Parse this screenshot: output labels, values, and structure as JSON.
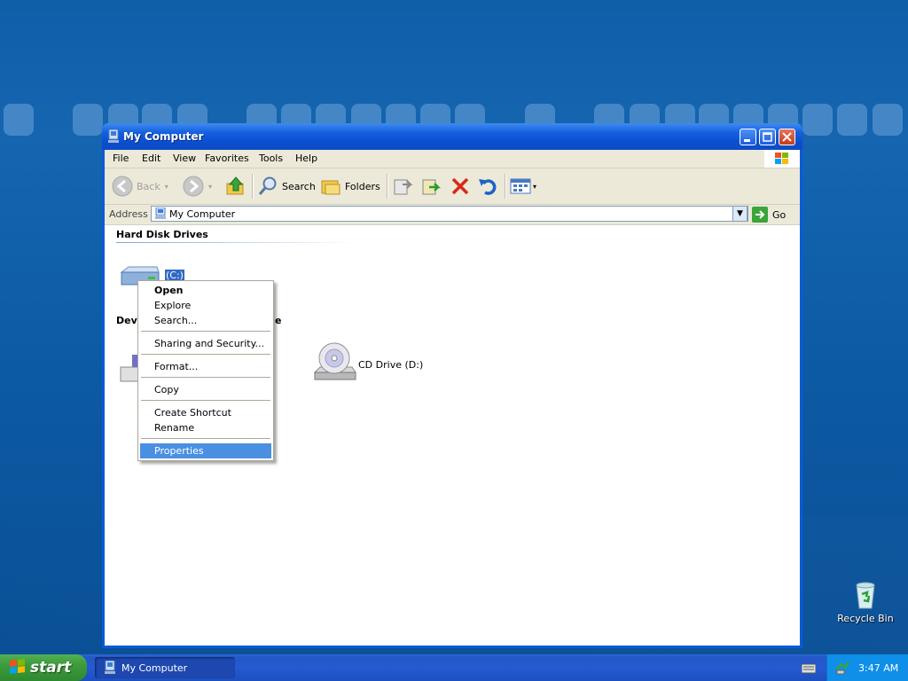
{
  "window": {
    "title": "My Computer"
  },
  "menubar": {
    "items": [
      "File",
      "Edit",
      "View",
      "Favorites",
      "Tools",
      "Help"
    ]
  },
  "toolbar": {
    "back_label": "Back",
    "search_label": "Search",
    "folders_label": "Folders"
  },
  "address": {
    "label": "Address",
    "value": "My Computer",
    "go_label": "Go"
  },
  "content": {
    "section_hard_disks": "Hard Disk Drives",
    "section_removable_visible": "Devi",
    "section_removable_tail": "e",
    "local_disk_label": "(C:)",
    "cd_drive_label": "CD Drive (D:)"
  },
  "context_menu": {
    "items": [
      "Open",
      "Explore",
      "Search...",
      "Sharing and Security...",
      "Format...",
      "Copy",
      "Create Shortcut",
      "Rename",
      "Properties"
    ]
  },
  "taskbar": {
    "start_label": "start",
    "task_label": "My Computer",
    "clock": "3:47 AM"
  },
  "desktop": {
    "recycle_bin_label": "Recycle Bin"
  }
}
